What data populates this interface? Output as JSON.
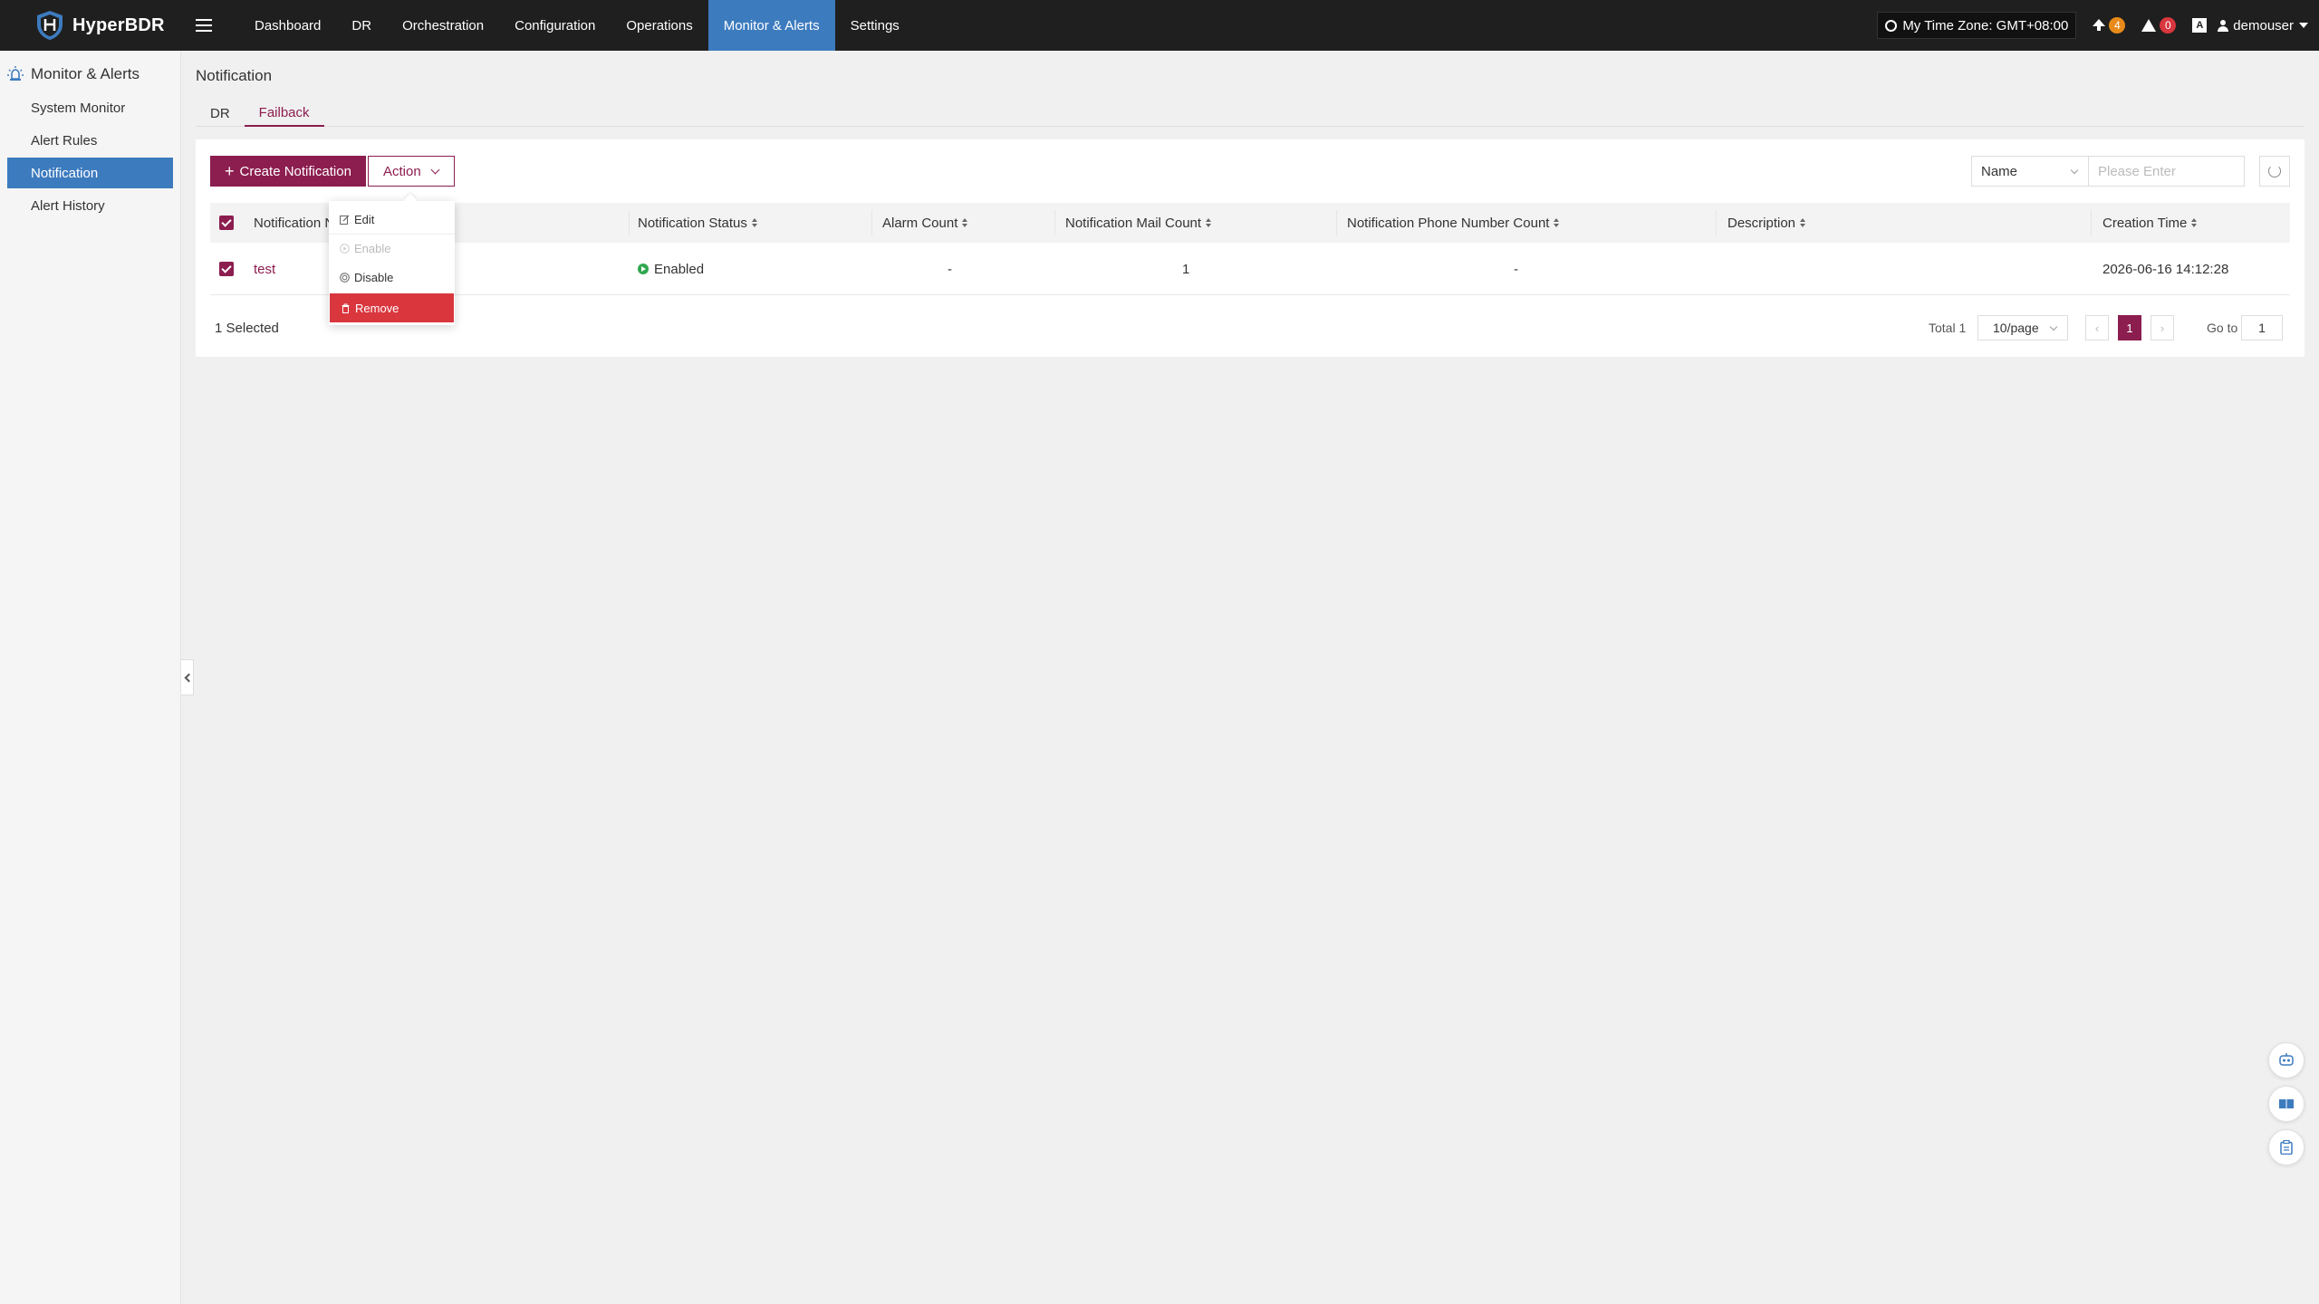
{
  "app": {
    "name": "HyperBDR"
  },
  "nav": {
    "items": [
      {
        "label": "Dashboard",
        "active": false
      },
      {
        "label": "DR",
        "active": false
      },
      {
        "label": "Orchestration",
        "active": false
      },
      {
        "label": "Configuration",
        "active": false
      },
      {
        "label": "Operations",
        "active": false
      },
      {
        "label": "Monitor & Alerts",
        "active": true
      },
      {
        "label": "Settings",
        "active": false
      }
    ]
  },
  "header": {
    "timezone": "My Time Zone: GMT+08:00",
    "upgrade_count": "4",
    "alert_count": "0",
    "lang_icon": "A",
    "username": "demouser"
  },
  "sidebar": {
    "title": "Monitor & Alerts",
    "items": [
      {
        "label": "System Monitor",
        "active": false
      },
      {
        "label": "Alert Rules",
        "active": false
      },
      {
        "label": "Notification",
        "active": true
      },
      {
        "label": "Alert History",
        "active": false
      }
    ]
  },
  "page": {
    "title": "Notification",
    "tabs": [
      {
        "label": "DR",
        "active": false
      },
      {
        "label": "Failback",
        "active": true
      }
    ]
  },
  "toolbar": {
    "create_label": "Create Notification",
    "action_label": "Action",
    "search_type": "Name",
    "search_placeholder": "Please Enter"
  },
  "table": {
    "columns": [
      "Notification Name",
      "Notification Status",
      "Alarm Count",
      "Notification Mail Count",
      "Notification Phone Number Count",
      "Description",
      "Creation Time"
    ],
    "rows": [
      {
        "name": "test",
        "status": "Enabled",
        "alarm_count": "-",
        "mail_count": "1",
        "phone_count": "-",
        "description": "",
        "creation_time": "2026-06-16 14:12:28"
      }
    ]
  },
  "footer": {
    "selected": "1 Selected",
    "total": "Total 1",
    "page_size": "10/page",
    "current_page": "1",
    "goto_label": "Go to",
    "goto_value": "1"
  },
  "action_menu": {
    "items": [
      {
        "label": "Edit",
        "disabled": false
      },
      {
        "label": "Enable",
        "disabled": true
      },
      {
        "label": "Disable",
        "disabled": false
      },
      {
        "label": "Remove",
        "disabled": false
      }
    ]
  },
  "colors": {
    "brand": "#8c1d4f",
    "nav_active": "#3d7bbf",
    "danger": "#d9363e",
    "success": "#2fa84f",
    "topbar": "#1f1f1f"
  }
}
